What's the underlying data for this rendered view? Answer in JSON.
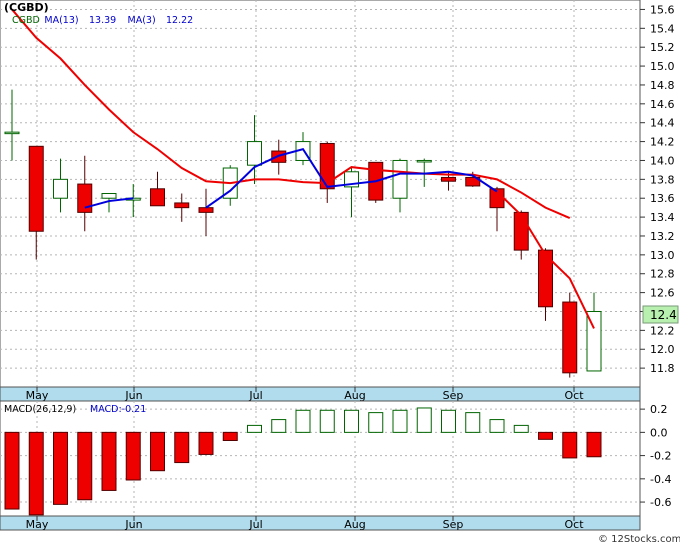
{
  "ticker": "(CGBD)",
  "legend_main": [
    {
      "label": "CGBD",
      "color": "#006400"
    },
    {
      "label": "MA(13)",
      "color": "#0000cc"
    },
    {
      "label": "13.39",
      "color": "#0000cc"
    },
    {
      "label": "MA(3)",
      "color": "#0000cc"
    },
    {
      "label": "12.22",
      "color": "#0000cc"
    }
  ],
  "legend_macd": [
    {
      "label": "MACD(26,12,9)",
      "color": "#000000"
    },
    {
      "label": "MACD:-0.21",
      "color": "#0000cc"
    }
  ],
  "price_label": "12.4",
  "credit": "© 12Stocks.com",
  "colors": {
    "up_fill": "#ffffff",
    "up_stroke": "#006400",
    "down_fill": "#ee0000",
    "down_stroke": "#550000",
    "ma13": "#ee0000",
    "ma3": "#0000dd",
    "axis_band": "#b0dced",
    "price_tag": "#b8f0b0",
    "grid": "#b5b5b5"
  },
  "chart_data": [
    {
      "type": "candlestick",
      "title": "(CGBD)",
      "x_tick_labels": [
        "May",
        "Jun",
        "Jul",
        "Aug",
        "Sep",
        "Oct"
      ],
      "y_ticks": [
        11.8,
        12.0,
        12.2,
        12.4,
        12.6,
        12.8,
        13.0,
        13.2,
        13.4,
        13.6,
        13.8,
        14.0,
        14.2,
        14.4,
        14.6,
        14.8,
        15.0,
        15.2,
        15.4,
        15.6
      ],
      "ylim": [
        11.6,
        15.7
      ],
      "grid": true,
      "bars": [
        {
          "open": 14.3,
          "high": 14.75,
          "low": 14.0,
          "close": 14.3
        },
        {
          "open": 14.15,
          "high": 14.15,
          "low": 12.95,
          "close": 13.25
        },
        {
          "open": 13.6,
          "high": 14.02,
          "low": 13.45,
          "close": 13.8
        },
        {
          "open": 13.75,
          "high": 14.05,
          "low": 13.25,
          "close": 13.45
        },
        {
          "open": 13.6,
          "high": 13.65,
          "low": 13.45,
          "close": 13.65
        },
        {
          "open": 13.58,
          "high": 13.75,
          "low": 13.4,
          "close": 13.6
        },
        {
          "open": 13.7,
          "high": 13.88,
          "low": 13.52,
          "close": 13.52
        },
        {
          "open": 13.55,
          "high": 13.65,
          "low": 13.35,
          "close": 13.5
        },
        {
          "open": 13.5,
          "high": 13.7,
          "low": 13.2,
          "close": 13.45
        },
        {
          "open": 13.6,
          "high": 13.95,
          "low": 13.52,
          "close": 13.92
        },
        {
          "open": 13.95,
          "high": 14.48,
          "low": 13.75,
          "close": 14.2
        },
        {
          "open": 14.1,
          "high": 14.22,
          "low": 13.85,
          "close": 13.98
        },
        {
          "open": 14.0,
          "high": 14.3,
          "low": 13.95,
          "close": 14.2
        },
        {
          "open": 14.18,
          "high": 14.2,
          "low": 13.55,
          "close": 13.7
        },
        {
          "open": 13.72,
          "high": 13.93,
          "low": 13.4,
          "close": 13.88
        },
        {
          "open": 13.98,
          "high": 13.98,
          "low": 13.55,
          "close": 13.58
        },
        {
          "open": 13.6,
          "high": 14.02,
          "low": 13.45,
          "close": 14.0
        },
        {
          "open": 14.0,
          "high": 14.02,
          "low": 13.72,
          "close": 14.0
        },
        {
          "open": 13.82,
          "high": 13.88,
          "low": 13.68,
          "close": 13.78
        },
        {
          "open": 13.82,
          "high": 13.88,
          "low": 13.72,
          "close": 13.73
        },
        {
          "open": 13.7,
          "high": 13.72,
          "low": 13.25,
          "close": 13.5
        },
        {
          "open": 13.45,
          "high": 13.47,
          "low": 12.95,
          "close": 13.05
        },
        {
          "open": 13.05,
          "high": 13.07,
          "low": 12.3,
          "close": 12.45
        },
        {
          "open": 12.5,
          "high": 12.6,
          "low": 11.7,
          "close": 11.75
        },
        {
          "open": 11.77,
          "high": 12.6,
          "low": 11.77,
          "close": 12.4
        }
      ],
      "series": [
        {
          "name": "MA(13)",
          "values": [
            15.6,
            15.3,
            15.08,
            14.8,
            14.54,
            14.3,
            14.12,
            13.92,
            13.78,
            13.76,
            13.8,
            13.8,
            13.77,
            13.76,
            13.93,
            13.9,
            13.88,
            13.86,
            13.85,
            13.85,
            13.8,
            13.66,
            13.5,
            13.39,
            null
          ]
        },
        {
          "name": "MA(3)",
          "values": [
            null,
            null,
            null,
            13.5,
            13.57,
            13.6,
            null,
            null,
            13.5,
            13.68,
            13.93,
            14.05,
            14.12,
            13.72,
            13.75,
            13.78,
            13.86,
            13.86,
            13.88,
            13.84,
            13.67,
            13.42,
            13.0,
            12.75,
            12.22
          ]
        }
      ]
    },
    {
      "type": "bar",
      "title": "MACD(26,12,9)",
      "x_tick_labels": [
        "May",
        "Jun",
        "Jul",
        "Aug",
        "Sep",
        "Oct"
      ],
      "y_ticks": [
        0.2,
        0.0,
        -0.2,
        -0.4,
        -0.6
      ],
      "ylim": [
        -0.72,
        0.27
      ],
      "grid": true,
      "values": [
        -0.66,
        -0.71,
        -0.62,
        -0.58,
        -0.5,
        -0.41,
        -0.33,
        -0.26,
        -0.19,
        -0.07,
        0.06,
        0.11,
        0.19,
        0.19,
        0.19,
        0.17,
        0.19,
        0.21,
        0.19,
        0.17,
        0.11,
        0.06,
        -0.06,
        -0.22,
        -0.21
      ]
    }
  ]
}
